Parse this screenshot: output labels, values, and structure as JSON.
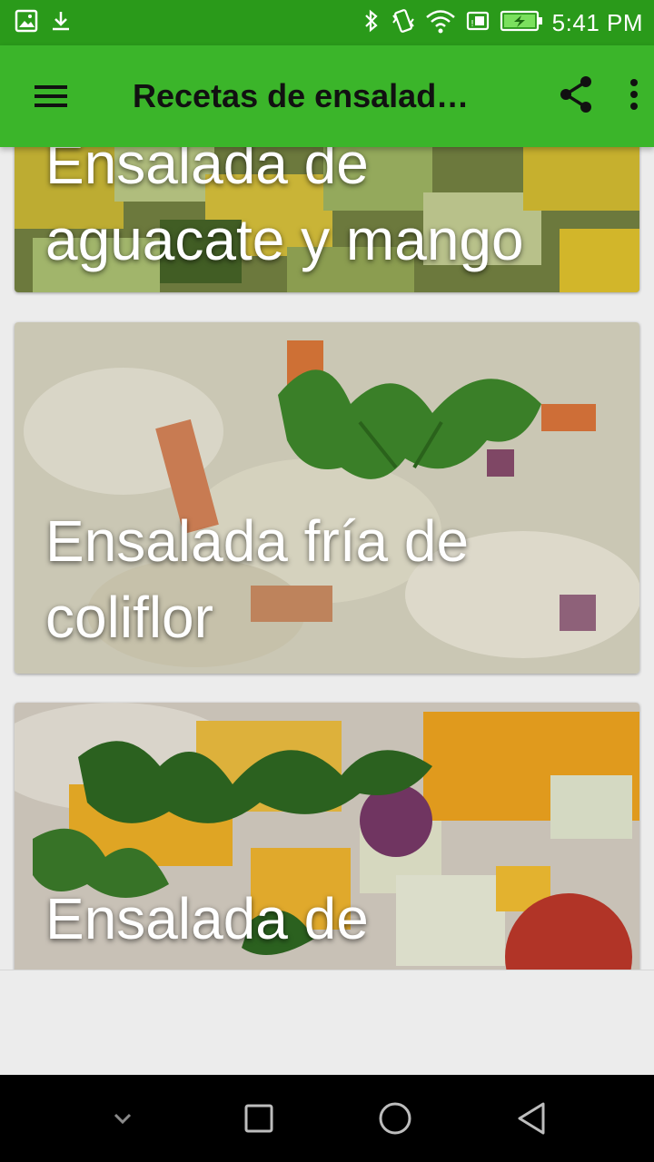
{
  "status_bar": {
    "time": "5:41 PM",
    "icons": [
      "image-icon",
      "download-icon",
      "bluetooth-icon",
      "vibrate-icon",
      "wifi-icon",
      "sim-icon",
      "battery-charging-icon"
    ]
  },
  "app_bar": {
    "title": "Recetas de ensalad…",
    "icons": [
      "menu-icon",
      "share-icon",
      "more-vert-icon"
    ]
  },
  "recipes": [
    {
      "title": "Ensalada de aguacate y mango"
    },
    {
      "title": "Ensalada fría de coliflor"
    },
    {
      "title": "Ensalada de"
    }
  ],
  "nav_bar": {
    "icons": [
      "chevron-down-icon",
      "recents-icon",
      "home-icon",
      "back-icon"
    ]
  },
  "colors": {
    "status_bar": "#2a9a1a",
    "app_bar": "#3bb52a",
    "background": "#ececec"
  }
}
